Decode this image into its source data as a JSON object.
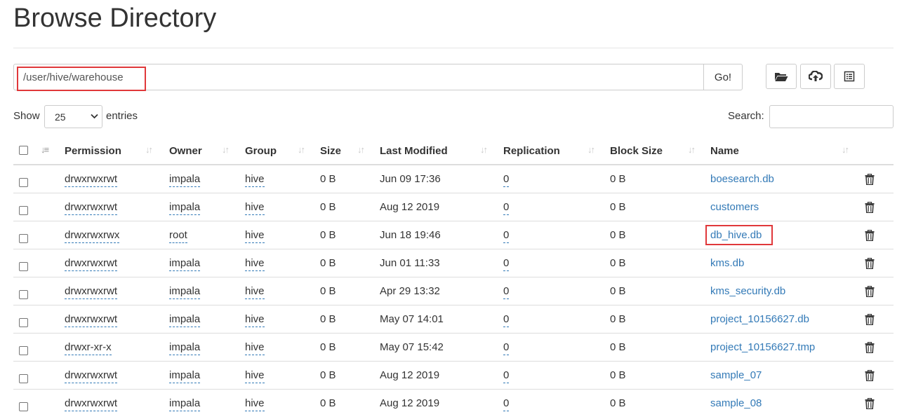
{
  "page": {
    "title": "Browse Directory"
  },
  "path_bar": {
    "value": "/user/hive/warehouse",
    "go_label": "Go!"
  },
  "toolbar": {
    "icons": [
      "folder-open-icon",
      "cloud-upload-icon",
      "list-icon"
    ]
  },
  "length": {
    "show_label": "Show",
    "selected": "25",
    "entries_label": "entries"
  },
  "search": {
    "label": "Search:",
    "value": ""
  },
  "table": {
    "columns": [
      "Permission",
      "Owner",
      "Group",
      "Size",
      "Last Modified",
      "Replication",
      "Block Size",
      "Name"
    ],
    "rows": [
      {
        "permission": "drwxrwxrwt",
        "owner": "impala",
        "group": "hive",
        "size": "0 B",
        "modified": "Jun 09 17:36",
        "replication": "0",
        "block_size": "0 B",
        "name": "boesearch.db"
      },
      {
        "permission": "drwxrwxrwt",
        "owner": "impala",
        "group": "hive",
        "size": "0 B",
        "modified": "Aug 12 2019",
        "replication": "0",
        "block_size": "0 B",
        "name": "customers"
      },
      {
        "permission": "drwxrwxrwx",
        "owner": "root",
        "group": "hive",
        "size": "0 B",
        "modified": "Jun 18 19:46",
        "replication": "0",
        "block_size": "0 B",
        "name": "db_hive.db"
      },
      {
        "permission": "drwxrwxrwt",
        "owner": "impala",
        "group": "hive",
        "size": "0 B",
        "modified": "Jun 01 11:33",
        "replication": "0",
        "block_size": "0 B",
        "name": "kms.db"
      },
      {
        "permission": "drwxrwxrwt",
        "owner": "impala",
        "group": "hive",
        "size": "0 B",
        "modified": "Apr 29 13:32",
        "replication": "0",
        "block_size": "0 B",
        "name": "kms_security.db"
      },
      {
        "permission": "drwxrwxrwt",
        "owner": "impala",
        "group": "hive",
        "size": "0 B",
        "modified": "May 07 14:01",
        "replication": "0",
        "block_size": "0 B",
        "name": "project_10156627.db"
      },
      {
        "permission": "drwxr-xr-x",
        "owner": "impala",
        "group": "hive",
        "size": "0 B",
        "modified": "May 07 15:42",
        "replication": "0",
        "block_size": "0 B",
        "name": "project_10156627.tmp"
      },
      {
        "permission": "drwxrwxrwt",
        "owner": "impala",
        "group": "hive",
        "size": "0 B",
        "modified": "Aug 12 2019",
        "replication": "0",
        "block_size": "0 B",
        "name": "sample_07"
      },
      {
        "permission": "drwxrwxrwt",
        "owner": "impala",
        "group": "hive",
        "size": "0 B",
        "modified": "Aug 12 2019",
        "replication": "0",
        "block_size": "0 B",
        "name": "sample_08"
      }
    ]
  },
  "colors": {
    "link": "#337ab7",
    "highlight": "#e0383a",
    "border": "#dddddd"
  }
}
